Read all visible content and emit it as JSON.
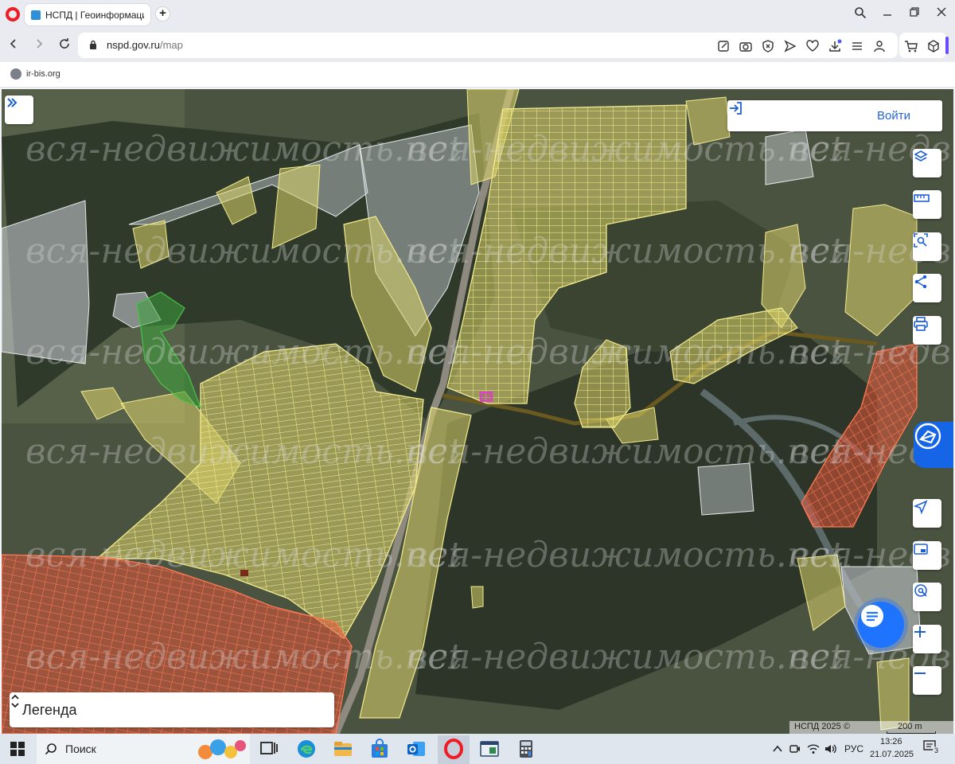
{
  "browser": {
    "tab_title": "НСПД | Геоинформацион",
    "new_tab": "+",
    "url_host": "nspd.gov.ru",
    "url_path": "/map",
    "bookmark": "ir-bis.org"
  },
  "map": {
    "login_label": "Войти",
    "legend_title": "Легенда",
    "copyright": "НСПД 2025 ©",
    "scale_label": "200 m",
    "watermark": "вся-недвижимость.net",
    "colors": {
      "satellite": "#4a5240",
      "parcel_yellow": "#dcd36a",
      "parcel_red": "#e2553a",
      "parcel_gray": "#b9bec4",
      "forest_green": "#3aa13a",
      "accent_blue": "#1e73ff"
    },
    "toolbar_icons": [
      "layers-icon",
      "ruler-icon",
      "area-select-icon",
      "share-icon",
      "print-icon",
      "navigate-icon",
      "minimap-icon",
      "geo-search-icon",
      "zoom-in-icon",
      "zoom-out-icon"
    ]
  },
  "taskbar": {
    "search_label": "Поиск",
    "language": "РУС",
    "time": "13:26",
    "date": "21.07.2025",
    "notifications": "3"
  }
}
